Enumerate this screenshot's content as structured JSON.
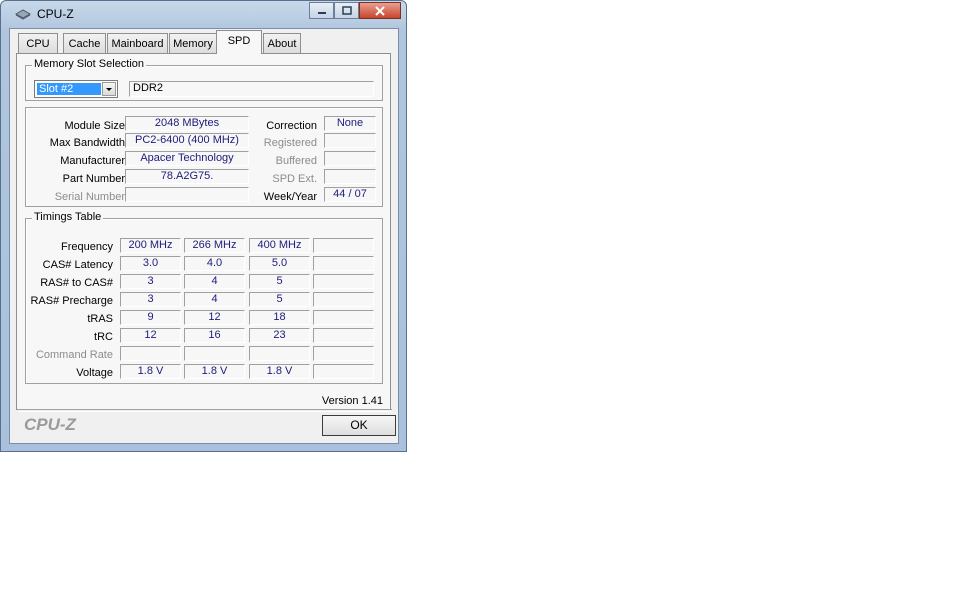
{
  "window": {
    "title": "CPU-Z"
  },
  "tabs": [
    {
      "label": "CPU"
    },
    {
      "label": "Cache"
    },
    {
      "label": "Mainboard"
    },
    {
      "label": "Memory"
    },
    {
      "label": "SPD"
    },
    {
      "label": "About"
    }
  ],
  "active_tab": "SPD",
  "slot": {
    "group_label": "Memory Slot Selection",
    "selected": "Slot #2",
    "type": "DDR2"
  },
  "module": {
    "module_size_label": "Module Size",
    "module_size": "2048 MBytes",
    "max_bandwidth_label": "Max Bandwidth",
    "max_bandwidth": "PC2-6400 (400 MHz)",
    "manufacturer_label": "Manufacturer",
    "manufacturer": "Apacer Technology",
    "part_number_label": "Part Number",
    "part_number": "78.A2G75.",
    "serial_number_label": "Serial Number",
    "serial_number": "",
    "correction_label": "Correction",
    "correction": "None",
    "registered_label": "Registered",
    "registered": "",
    "buffered_label": "Buffered",
    "buffered": "",
    "spd_ext_label": "SPD Ext.",
    "spd_ext": "",
    "week_year_label": "Week/Year",
    "week_year": "44 / 07"
  },
  "timings": {
    "group_label": "Timings Table",
    "rows": [
      {
        "label": "Frequency",
        "values": [
          "200 MHz",
          "266 MHz",
          "400 MHz",
          ""
        ],
        "disabled": false
      },
      {
        "label": "CAS# Latency",
        "values": [
          "3.0",
          "4.0",
          "5.0",
          ""
        ],
        "disabled": false
      },
      {
        "label": "RAS# to CAS#",
        "values": [
          "3",
          "4",
          "5",
          ""
        ],
        "disabled": false
      },
      {
        "label": "RAS# Precharge",
        "values": [
          "3",
          "4",
          "5",
          ""
        ],
        "disabled": false
      },
      {
        "label": "tRAS",
        "values": [
          "9",
          "12",
          "18",
          ""
        ],
        "disabled": false
      },
      {
        "label": "tRC",
        "values": [
          "12",
          "16",
          "23",
          ""
        ],
        "disabled": false
      },
      {
        "label": "Command Rate",
        "values": [
          "",
          "",
          "",
          ""
        ],
        "disabled": true
      },
      {
        "label": "Voltage",
        "values": [
          "1.8 V",
          "1.8 V",
          "1.8 V",
          ""
        ],
        "disabled": false
      }
    ]
  },
  "version": "Version 1.41",
  "footer": {
    "logo": "CPU-Z",
    "ok_label": "OK"
  },
  "colors": {
    "value_text": "#1c1c7c",
    "selection": "#3399ff"
  }
}
